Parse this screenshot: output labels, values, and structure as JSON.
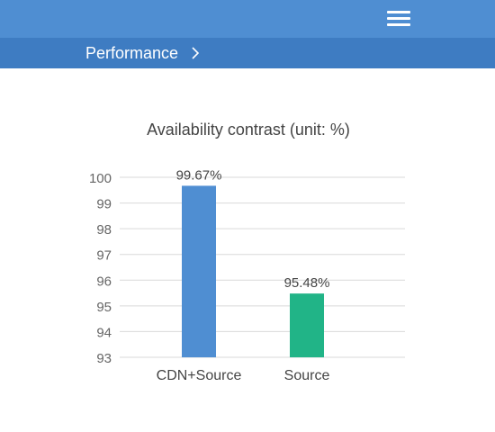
{
  "header": {
    "menu_icon": "hamburger-menu-icon",
    "color": "#4f8ed2"
  },
  "breadcrumb": {
    "label": "Performance",
    "chevron_icon": "chevron-right-icon",
    "color": "#3e7cc2"
  },
  "chart_data": {
    "type": "bar",
    "title": "Availability contrast (unit: %)",
    "categories": [
      "CDN+Source",
      "Source"
    ],
    "values": [
      99.67,
      95.48
    ],
    "data_labels": [
      "99.67%",
      "95.48%"
    ],
    "colors": [
      "#4f8ed2",
      "#21b487"
    ],
    "ylim": [
      93,
      100
    ],
    "yticks": [
      "93",
      "94",
      "95",
      "96",
      "97",
      "98",
      "99",
      "100"
    ],
    "xlabel": "",
    "ylabel": "",
    "grid": true
  }
}
